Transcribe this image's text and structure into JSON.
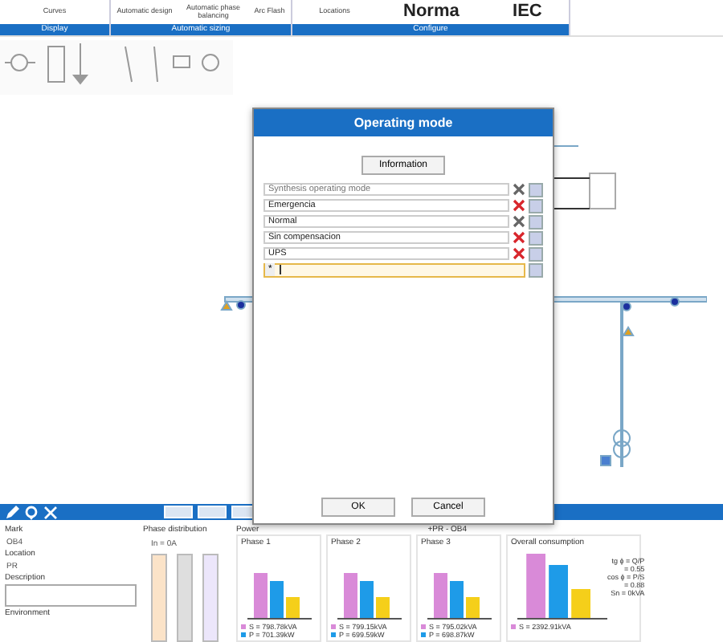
{
  "ribbon": {
    "groups": [
      {
        "label": "Display",
        "items": [
          {
            "label": "Curves",
            "kind": "small"
          }
        ]
      },
      {
        "label": "Automatic sizing",
        "items": [
          {
            "label": "Automatic design",
            "kind": "small"
          },
          {
            "label": "Automatic phase balancing",
            "kind": "small"
          },
          {
            "label": "Arc Flash",
            "kind": "small"
          }
        ]
      },
      {
        "label": "Configure",
        "items": [
          {
            "label": "Locations",
            "kind": "small"
          },
          {
            "label": "Norma",
            "kind": "big"
          },
          {
            "label": "IEC",
            "kind": "big"
          }
        ]
      }
    ]
  },
  "dialog": {
    "title": "Operating mode",
    "info_button": "Information",
    "rows": [
      {
        "kind": "placeholder",
        "placeholder": "Synthesis operating mode",
        "delete_enabled": false,
        "selected": false
      },
      {
        "kind": "entry",
        "value": "Emergencia",
        "delete_enabled": true,
        "selected": false
      },
      {
        "kind": "entry",
        "value": "Normal",
        "delete_enabled": false,
        "selected": false
      },
      {
        "kind": "entry",
        "value": "Sin compensacion",
        "delete_enabled": true,
        "selected": false
      },
      {
        "kind": "entry",
        "value": "UPS",
        "delete_enabled": true,
        "selected": false
      },
      {
        "kind": "new",
        "marker": "*",
        "selected": true
      }
    ],
    "buttons": [
      "OK",
      "Cancel"
    ]
  },
  "properties": {
    "fields": [
      {
        "label": "Mark",
        "value": "OB4",
        "kind": "text"
      },
      {
        "label": "Location",
        "value": "PR",
        "kind": "text"
      },
      {
        "label": "Description",
        "kind": "area"
      },
      {
        "label": "Environment",
        "kind": "label"
      }
    ]
  },
  "phase_distribution": {
    "title": "Phase distribution",
    "legend": "In = 0A"
  },
  "power": {
    "title": "Power",
    "subtitle": "+PR - OB4",
    "phases": [
      {
        "title": "Phase 1",
        "lines": [
          "S = 798.78kVA",
          "P = 701.39kW"
        ]
      },
      {
        "title": "Phase 2",
        "lines": [
          "S = 799.15kVA",
          "P = 699.59kW"
        ]
      },
      {
        "title": "Phase 3",
        "lines": [
          "S = 795.02kVA",
          "P = 698.87kW"
        ]
      }
    ],
    "overall": {
      "title": "Overall consumption",
      "formulas": [
        "tg ϕ = Q/P",
        "= 0.55",
        "cos ϕ = P/S",
        "= 0.88",
        "Sn = 0kVA"
      ],
      "lines": [
        "S = 2392.91kVA"
      ]
    }
  }
}
